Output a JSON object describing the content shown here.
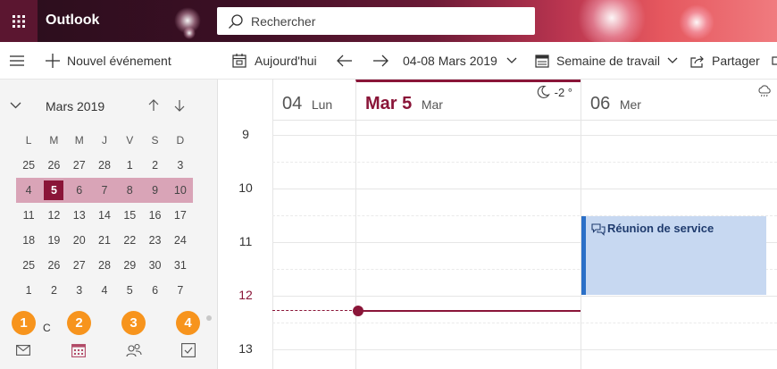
{
  "app": {
    "title": "Outlook"
  },
  "search": {
    "placeholder": "Rechercher"
  },
  "toolbar": {
    "new_event": "Nouvel événement",
    "today": "Aujourd'hui",
    "date_range": "04-08 Mars 2019",
    "view": "Semaine de travail",
    "share": "Partager"
  },
  "mini_calendar": {
    "month_label": "Mars 2019",
    "weekdays": [
      "L",
      "M",
      "M",
      "J",
      "V",
      "S",
      "D"
    ],
    "weeks": [
      [
        "25",
        "26",
        "27",
        "28",
        "1",
        "2",
        "3"
      ],
      [
        "4",
        "5",
        "6",
        "7",
        "8",
        "9",
        "10"
      ],
      [
        "11",
        "12",
        "13",
        "14",
        "15",
        "16",
        "17"
      ],
      [
        "18",
        "19",
        "20",
        "21",
        "22",
        "23",
        "24"
      ],
      [
        "25",
        "26",
        "27",
        "28",
        "29",
        "30",
        "31"
      ],
      [
        "1",
        "2",
        "3",
        "4",
        "5",
        "6",
        "7"
      ]
    ],
    "selected_week_index": 1,
    "today": "5"
  },
  "day_headers": [
    {
      "num": "04",
      "name": "Lun"
    },
    {
      "num": "Mar 5",
      "name": "Mar",
      "weather": "-2 °"
    },
    {
      "num": "06",
      "name": "Mer"
    }
  ],
  "hours": [
    "9",
    "10",
    "11",
    "12",
    "13"
  ],
  "current_hour": "12",
  "event": {
    "title": "Réunion de service"
  },
  "badges": [
    "1",
    "2",
    "3",
    "4"
  ],
  "left_partial_text": "C",
  "colors": {
    "accent": "#8a1538",
    "event_bg": "#c7d8f1",
    "event_border": "#2b6fc7",
    "badge": "#f7941d",
    "week_highlight": "#d9a4b7"
  }
}
